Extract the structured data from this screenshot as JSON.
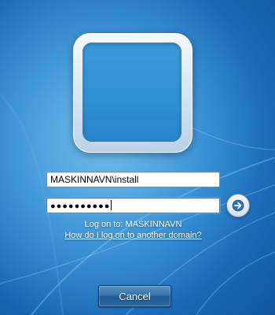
{
  "user_tile": {
    "icon": "user-picture-frame"
  },
  "login": {
    "username_value": "MASKINNAVN\\install",
    "password_masked": "●●●●●●●●●●",
    "logon_to": "Log on to: MASKINNAVN",
    "domain_link": "How do I log on to another domain?",
    "submit_icon": "arrow-right-icon"
  },
  "actions": {
    "cancel_label": "Cancel"
  },
  "colors": {
    "background": "#1d72bd",
    "text": "#ffffff",
    "button": "#2f6fa8"
  }
}
